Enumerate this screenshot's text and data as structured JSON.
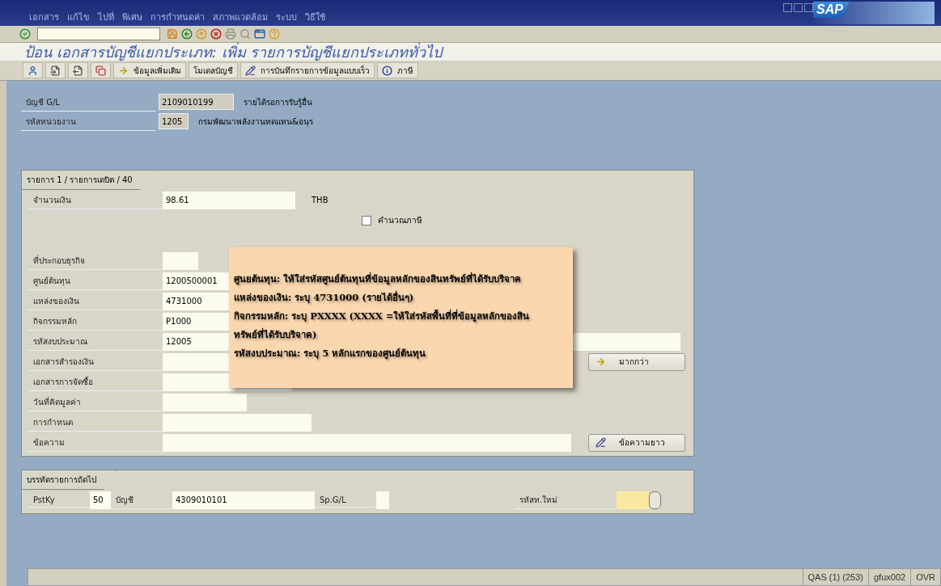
{
  "logo": "SAP",
  "menu": [
    {
      "label": "เอกสาร"
    },
    {
      "label": "แก้ไข"
    },
    {
      "label": "ไปที่"
    },
    {
      "label": "พิเศษ"
    },
    {
      "label": "การกำหนดค่า"
    },
    {
      "label": "สภาพแวดล้อม"
    },
    {
      "label": "ระบบ"
    },
    {
      "label": "วิธีใช้"
    }
  ],
  "title": "ป้อน เอกสารบัญชีแยกประเภท: เพิ่ม รายการบัญชีแยกประเภททั่วไป",
  "app_toolbar": [
    {
      "kind": "icon"
    },
    {
      "kind": "icon"
    },
    {
      "kind": "icon"
    },
    {
      "kind": "icon"
    },
    {
      "kind": "text",
      "label": "ข้อมูลเพิ่มเติม"
    },
    {
      "kind": "text",
      "label": "โมเดลบัญชี"
    },
    {
      "kind": "text",
      "label": "การบันทึกรายการข้อมูลแบบเร็ว"
    },
    {
      "kind": "text",
      "label": "ภาษี"
    }
  ],
  "header_fields": [
    {
      "label": "บัญชี G/L",
      "value": "2109010199",
      "description": "รายได้รอการรับรู้อื่น"
    },
    {
      "label": "รหัสหน่วยงาน",
      "value": "1205",
      "description": "กรมพัฒนาพลังงานทดแทน&อนุร"
    }
  ],
  "item_panel": {
    "tab": "รายการ 1 / รายการเดบิต / 40",
    "amount_label": "จำนวนเงิน",
    "amount": "98.61",
    "currency": "THB",
    "tax_checkbox": {
      "label": "คำนวณภาษี",
      "checked": false
    },
    "fields": [
      {
        "label": "ที่ประกอบธุรกิจ"
      },
      {
        "label": "ศูนย์ต้นทุน",
        "value": "1200500001"
      },
      {
        "label": "แหล่งของเงิน",
        "value": "4731000"
      },
      {
        "label": "กิจกรรมหลัก",
        "value": "P1000"
      },
      {
        "label": "รหัสงบประมาณ",
        "value": "12005"
      },
      {
        "label": "เอกสารสำรองเงิน",
        "button": "มากกว่า"
      },
      {
        "label": "เอกสารการจัดซื้อ"
      },
      {
        "label": "วันที่คิดมูลค่า"
      },
      {
        "label": "การกำหนด"
      },
      {
        "label": "ข้อความ",
        "button": "ข้อความยาว"
      }
    ]
  },
  "callout": {
    "lines": [
      "ศูนยต้นทุน: ให้ใส่รหัสศูนย์ต้นทุนที่ข้อมูลหลักของสินทรัพย์ที่ได้รับบริจาค",
      "แหล่งของเงิน: ระบุ 4731000 (รายได้อื่นๆ)",
      "กิจกรรมหลัก:  ระบุ PXXXX (XXXX =ให้ใส่รหัสพื้นที่ที่ข้อมูลหลักของสิน",
      "ทรัพย์ที่ได้รับบริจาค)",
      "รหัสงบประมาณ: ระบุ 5 หลักแรกของศูนย์ต้นทุน"
    ]
  },
  "next_line": {
    "tab": "บรรทัดรายการถัดไป",
    "posting_key_label": "PstKy",
    "posting_key": "50",
    "account_label": "บัญชี",
    "account": "4309010101",
    "spgl_label": "Sp.G/L",
    "new_code_label": "รหัสท.ใหม่"
  },
  "status_bar": {
    "system": "QAS (1) (253)",
    "server": "gfux002",
    "mode": "OVR"
  }
}
